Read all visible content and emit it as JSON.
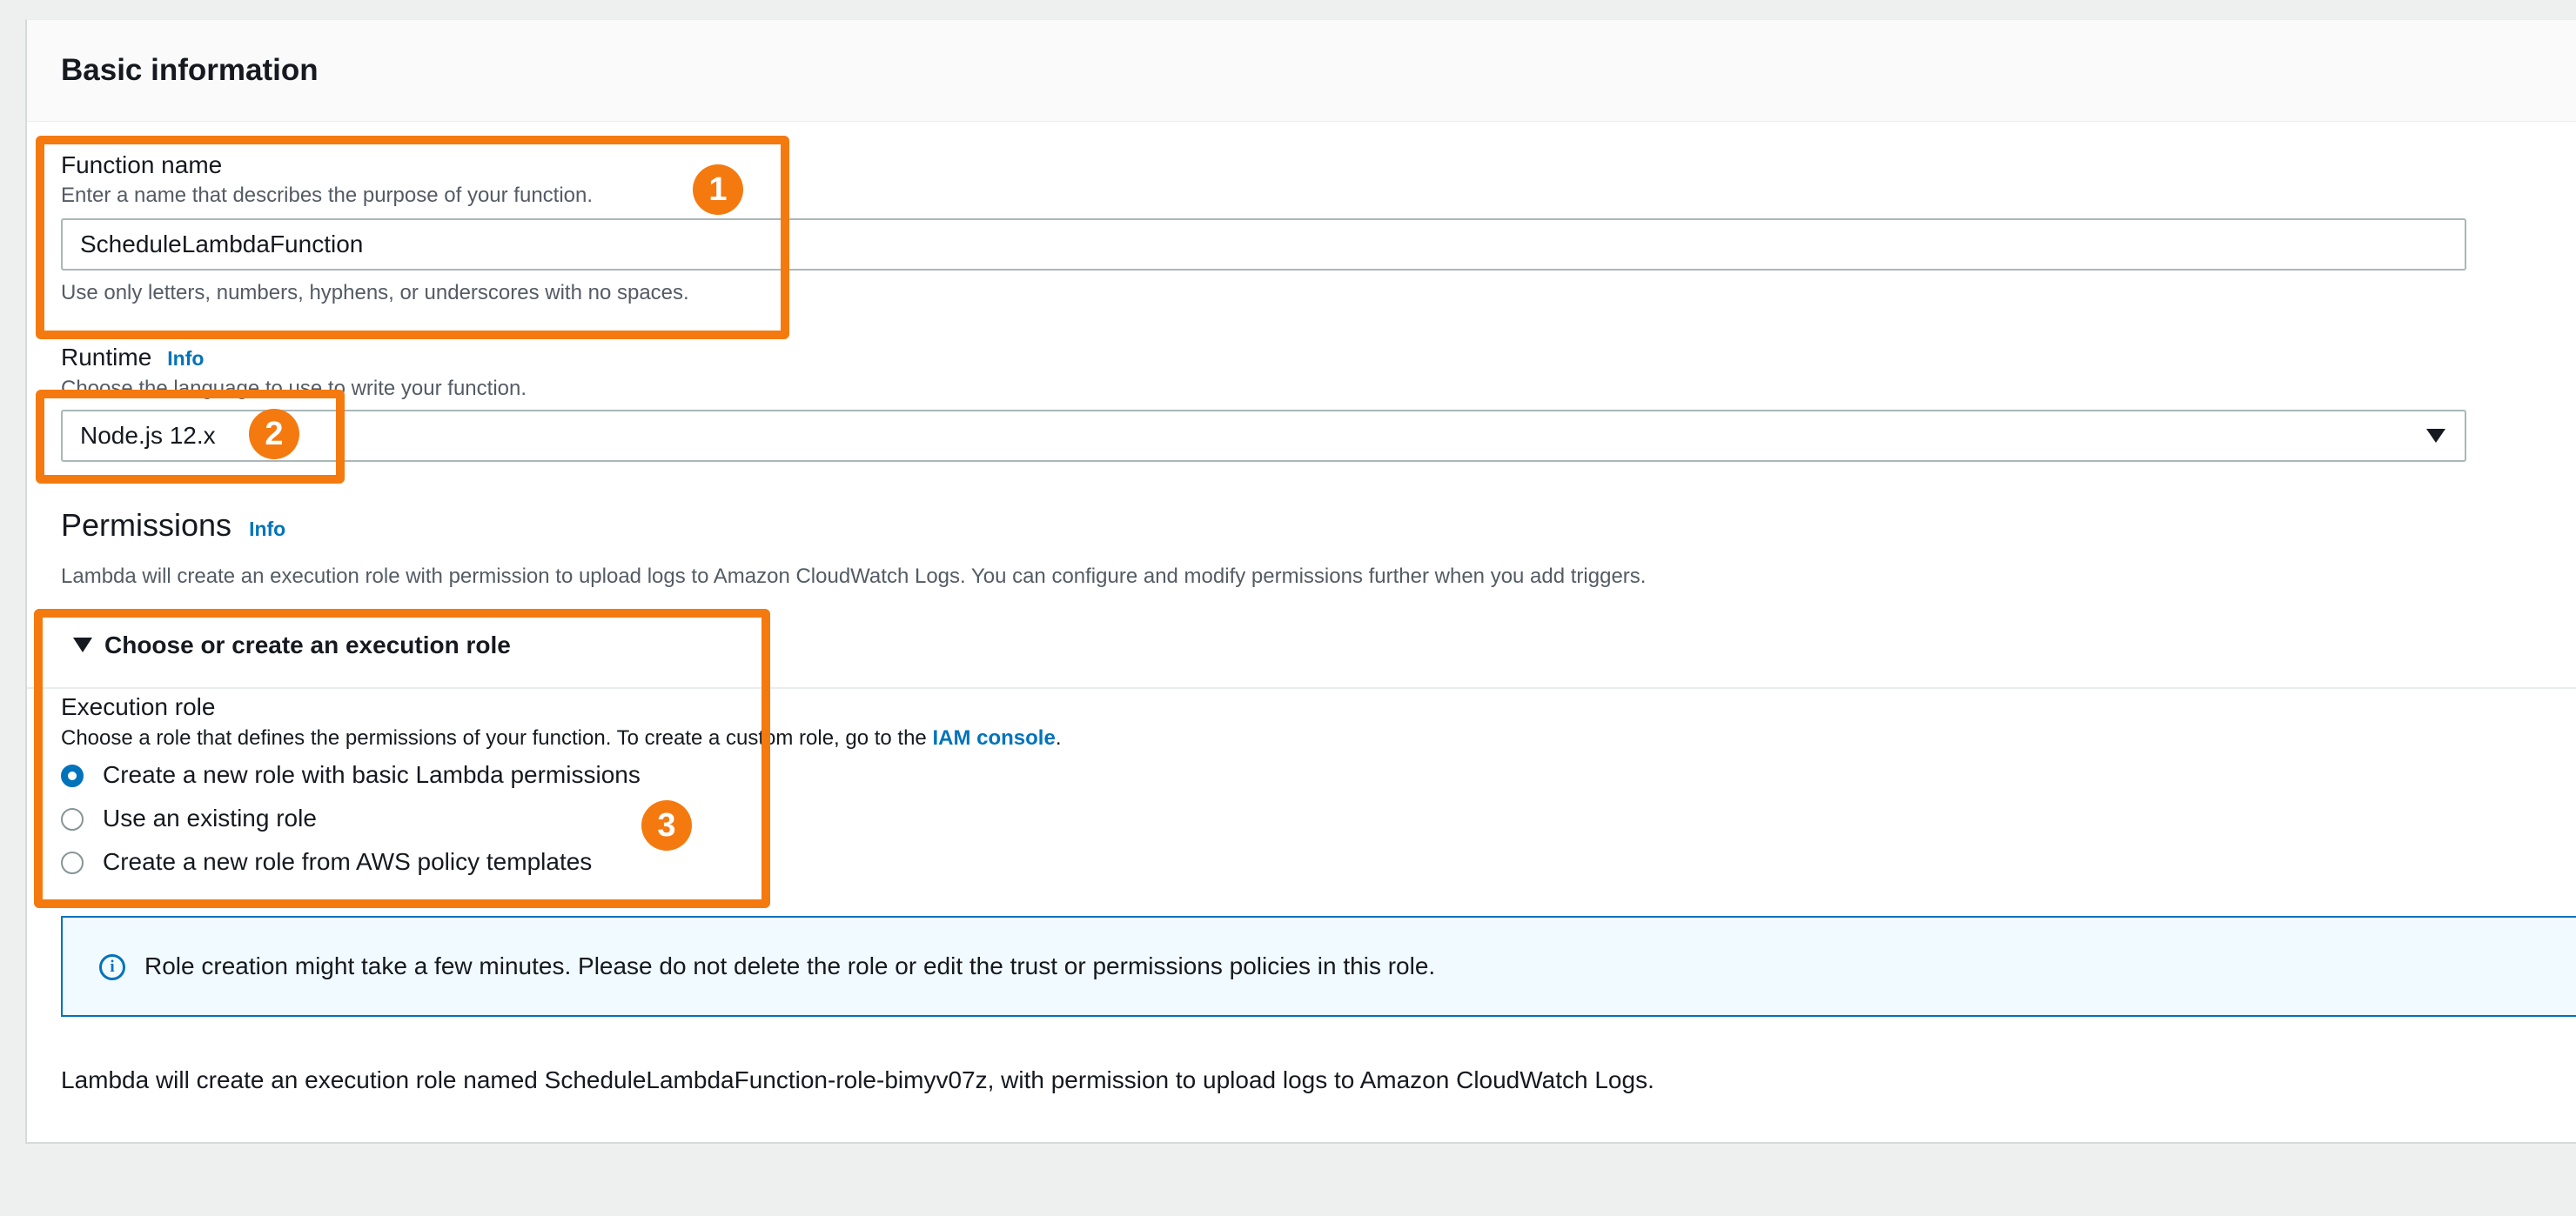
{
  "panel": {
    "title": "Basic information"
  },
  "function_name": {
    "label": "Function name",
    "description": "Enter a name that describes the purpose of your function.",
    "value": "ScheduleLambdaFunction",
    "constraint": "Use only letters, numbers, hyphens, or underscores with no spaces."
  },
  "runtime": {
    "label": "Runtime",
    "info": "Info",
    "description": "Choose the language to use to write your function.",
    "selected": "Node.js 12.x"
  },
  "permissions": {
    "title": "Permissions",
    "info": "Info",
    "description": "Lambda will create an execution role with permission to upload logs to Amazon CloudWatch Logs. You can configure and modify permissions further when you add triggers.",
    "expander_label": "Choose or create an execution role",
    "execution_role": {
      "label": "Execution role",
      "description_prefix": "Choose a role that defines the permissions of your function. To create a custom role, go to the ",
      "description_link": "IAM console",
      "description_suffix": ".",
      "options": [
        {
          "label": "Create a new role with basic Lambda permissions",
          "checked": true
        },
        {
          "label": "Use an existing role",
          "checked": false
        },
        {
          "label": "Create a new role from AWS policy templates",
          "checked": false
        }
      ]
    },
    "alert": "Role creation might take a few minutes. Please do not delete the role or edit the trust or permissions policies in this role.",
    "footer": "Lambda will create an execution role named ScheduleLambdaFunction-role-bimyv07z, with permission to upload logs to Amazon CloudWatch Logs."
  },
  "annotations": {
    "badge1": "1",
    "badge2": "2",
    "badge3": "3"
  },
  "colors": {
    "highlight": "#f47a10",
    "link": "#0073bb",
    "alert_bg": "#f1faff"
  },
  "icons": {
    "info_alert": "info-circle-icon",
    "select_caret": "caret-down-icon",
    "expander": "caret-down-icon"
  }
}
